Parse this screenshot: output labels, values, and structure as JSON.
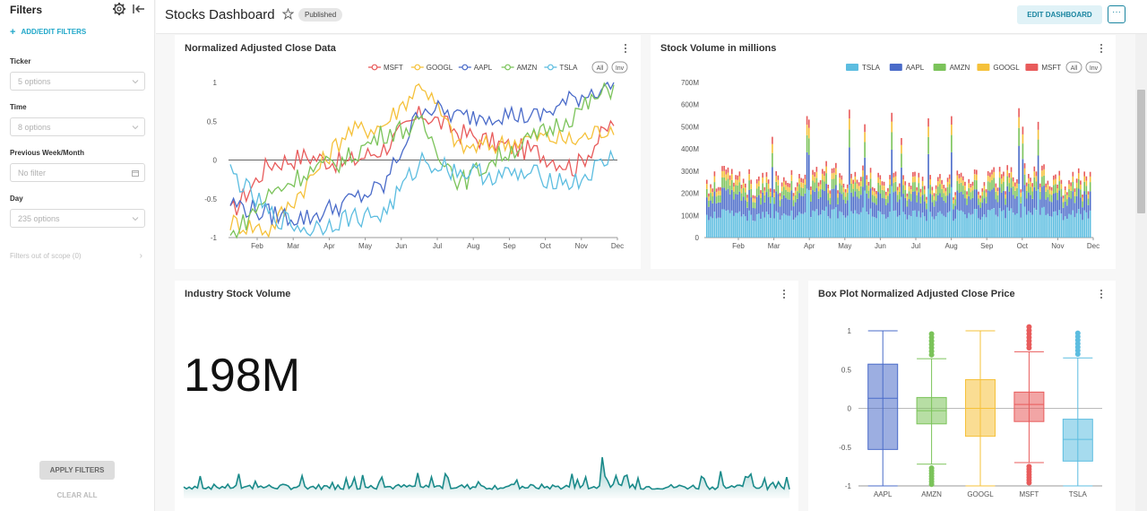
{
  "sidebar": {
    "title": "Filters",
    "add_label": "ADD/EDIT FILTERS",
    "filters": [
      {
        "label": "Ticker",
        "value": "5 options"
      },
      {
        "label": "Time",
        "value": "8 options"
      },
      {
        "label": "Previous Week/Month",
        "value": "No filter"
      },
      {
        "label": "Day",
        "value": "235 options"
      }
    ],
    "out_of_scope": "Filters out of scope (0)",
    "apply_label": "APPLY FILTERS",
    "clear_label": "CLEAR ALL"
  },
  "header": {
    "title": "Stocks Dashboard",
    "badge": "Published",
    "edit_label": "EDIT DASHBOARD",
    "more_label": "···"
  },
  "cards": {
    "line": {
      "title": "Normalized Adjusted Close Data",
      "legend_all": "All",
      "legend_inv": "Inv"
    },
    "volume": {
      "title": "Stock Volume in millions",
      "legend_all": "All",
      "legend_inv": "Inv"
    },
    "industry": {
      "title": "Industry Stock Volume",
      "big_number": "198M"
    },
    "box": {
      "title": "Box Plot Normalized Adjusted Close Price"
    }
  },
  "chart_data": [
    {
      "type": "line",
      "title": "Normalized Adjusted Close Data",
      "x": [
        "Feb",
        "Mar",
        "Apr",
        "May",
        "Jun",
        "Jul",
        "Aug",
        "Sep",
        "Oct",
        "Nov",
        "Dec"
      ],
      "ylim": [
        -1,
        1
      ],
      "yticks": [
        1,
        0.5,
        0,
        -0.5,
        -1
      ],
      "legend": "top-right",
      "series": [
        {
          "name": "MSFT",
          "color": "#e85b5b",
          "values": [
            -0.7,
            -0.05,
            0.05,
            -0.05,
            0.15,
            0.6,
            0.35,
            0.2,
            0.1,
            -0.1,
            0.5
          ]
        },
        {
          "name": "GOOGL",
          "color": "#f5c13a",
          "values": [
            -0.8,
            -0.9,
            -0.3,
            0.35,
            0.45,
            1.0,
            0.15,
            0.2,
            0.3,
            0.25,
            0.45
          ]
        },
        {
          "name": "AAPL",
          "color": "#4a6bc9",
          "values": [
            -0.55,
            -0.7,
            -0.75,
            -0.55,
            -0.35,
            0.7,
            0.55,
            0.6,
            0.55,
            0.8,
            1.0
          ]
        },
        {
          "name": "AMZN",
          "color": "#7bc35a",
          "values": [
            -1.0,
            -0.45,
            -0.15,
            0.0,
            0.35,
            0.45,
            -0.3,
            0.05,
            0.3,
            0.6,
            0.95
          ]
        },
        {
          "name": "TSLA",
          "color": "#5cbde0",
          "values": [
            -0.15,
            -0.7,
            -0.9,
            -0.75,
            -0.7,
            0.0,
            -0.15,
            -0.2,
            -0.2,
            -0.3,
            0.05
          ]
        }
      ]
    },
    {
      "type": "bar",
      "title": "Stock Volume in millions",
      "x": [
        "Feb",
        "Mar",
        "Apr",
        "May",
        "Jun",
        "Jul",
        "Aug",
        "Sep",
        "Oct",
        "Nov",
        "Dec"
      ],
      "yticks": [
        "0",
        "100M",
        "200M",
        "300M",
        "400M",
        "500M",
        "600M",
        "700M"
      ],
      "ylim": [
        0,
        700
      ],
      "stacked": true,
      "legend": "top-right",
      "series": [
        {
          "name": "TSLA",
          "color": "#5cbde0",
          "values": [
            110,
            105,
            100,
            120,
            115,
            105,
            100,
            110,
            120,
            115,
            105
          ]
        },
        {
          "name": "AAPL",
          "color": "#4a6bc9",
          "values": [
            85,
            80,
            75,
            90,
            80,
            75,
            70,
            75,
            85,
            80,
            75
          ]
        },
        {
          "name": "AMZN",
          "color": "#7bc35a",
          "values": [
            40,
            38,
            35,
            42,
            38,
            36,
            35,
            36,
            40,
            38,
            36
          ]
        },
        {
          "name": "GOOGL",
          "color": "#f5c13a",
          "values": [
            25,
            24,
            22,
            26,
            24,
            22,
            21,
            22,
            24,
            23,
            22
          ]
        },
        {
          "name": "MSFT",
          "color": "#e85b5b",
          "values": [
            20,
            19,
            18,
            21,
            19,
            18,
            17,
            18,
            20,
            19,
            18
          ]
        }
      ]
    },
    {
      "type": "area",
      "title": "Industry Stock Volume",
      "color": "#1a8a8a"
    },
    {
      "type": "box",
      "title": "Box Plot Normalized Adjusted Close Price",
      "categories": [
        "AAPL",
        "AMZN",
        "GOOGL",
        "MSFT",
        "TSLA"
      ],
      "ylim": [
        -1,
        1
      ],
      "yticks": [
        1,
        0.5,
        0,
        -0.5,
        -1
      ],
      "boxes": [
        {
          "name": "AAPL",
          "color": "#4a6bc9",
          "min": -1.0,
          "q1": -0.53,
          "median": 0.13,
          "q3": 0.57,
          "max": 1.0
        },
        {
          "name": "AMZN",
          "color": "#7bc35a",
          "min": -0.72,
          "q1": -0.2,
          "median": -0.03,
          "q3": 0.14,
          "max": 0.64
        },
        {
          "name": "GOOGL",
          "color": "#f5c13a",
          "min": -1.0,
          "q1": -0.36,
          "median": 0.0,
          "q3": 0.37,
          "max": 1.0
        },
        {
          "name": "MSFT",
          "color": "#e85b5b",
          "min": -0.7,
          "q1": -0.17,
          "median": 0.05,
          "q3": 0.21,
          "max": 0.73
        },
        {
          "name": "TSLA",
          "color": "#5cbde0",
          "min": -1.0,
          "q1": -0.68,
          "median": -0.4,
          "q3": -0.14,
          "max": 0.65
        }
      ]
    }
  ]
}
